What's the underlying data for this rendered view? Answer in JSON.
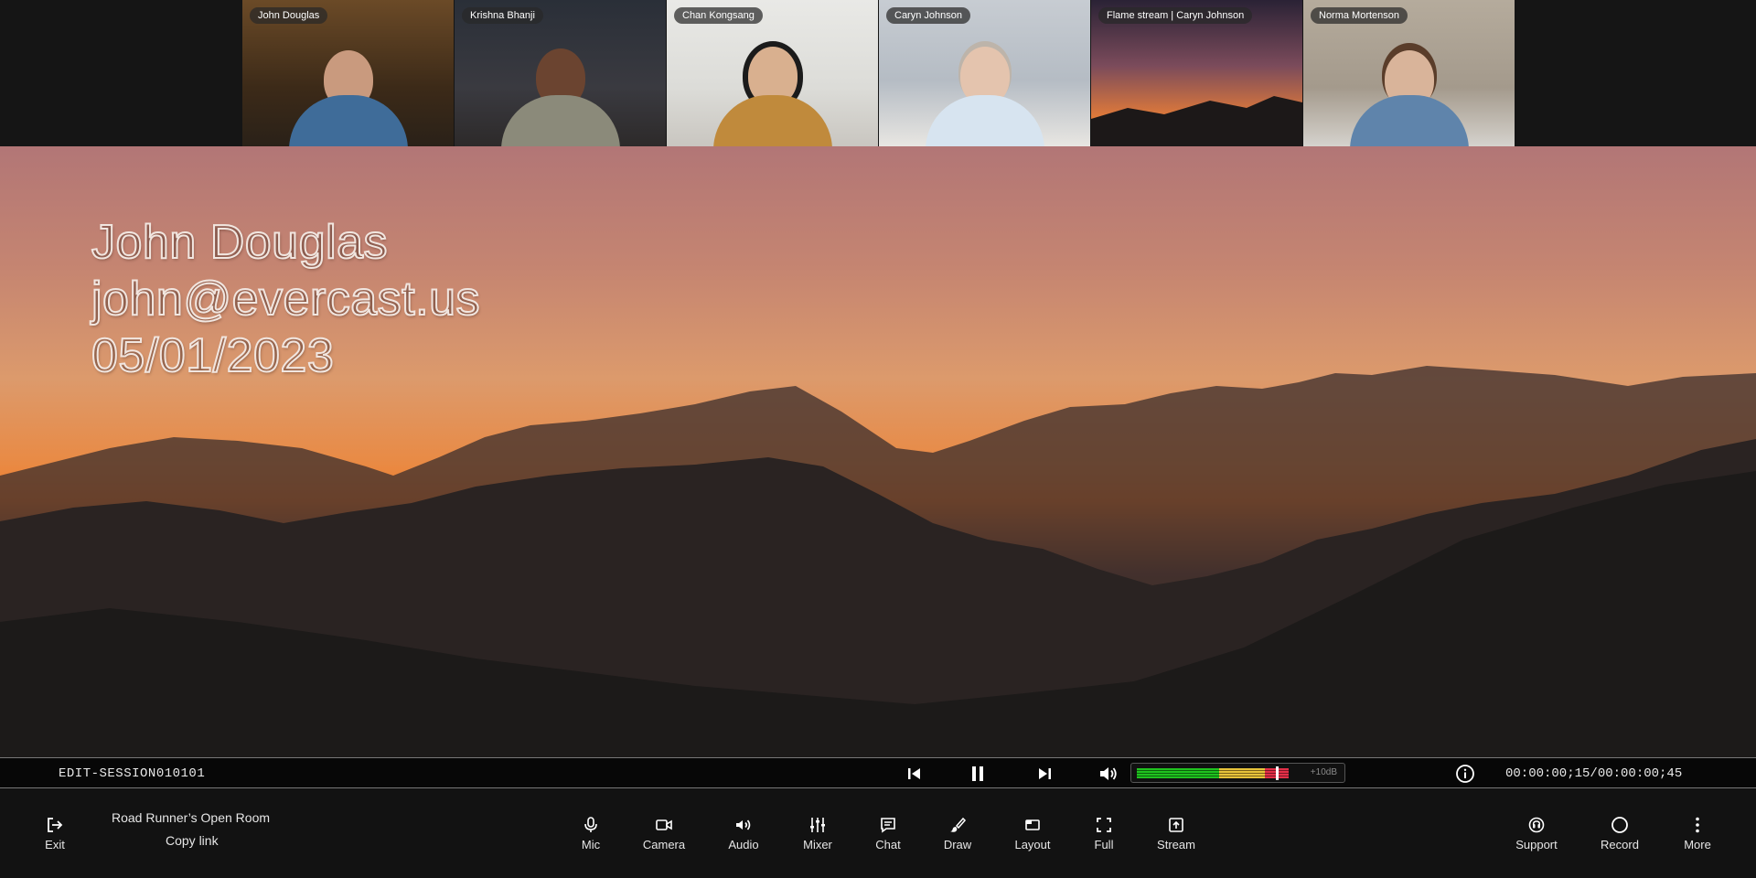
{
  "participants": [
    {
      "name": "John Douglas",
      "skin": "#c99a7e",
      "shirt": "#3f6c99"
    },
    {
      "name": "Krishna Bhanji",
      "skin": "#6b4430",
      "shirt": "#8b8a7a"
    },
    {
      "name": "Chan Kongsang",
      "skin": "#d9b08f",
      "shirt": "#c08a3c"
    },
    {
      "name": "Caryn Johnson",
      "skin": "#e4c4ae",
      "shirt": "#d7e4f0"
    },
    {
      "name": "Flame stream | Caryn Johnson",
      "skin": "",
      "shirt": ""
    },
    {
      "name": "Norma Mortenson",
      "skin": "#d9b49a",
      "shirt": "#5f84ab"
    }
  ],
  "stage": {
    "lines": [
      "John Douglas",
      "john@evercast.us",
      "05/01/2023"
    ]
  },
  "transport": {
    "session_name": "EDIT-SESSION010101",
    "meter_label": "+10dB",
    "meter_level": 0.72,
    "timecode": "00:00:00;15/00:00:00;45"
  },
  "room": {
    "name": "Road Runner’s Open Room",
    "copy_link": "Copy link"
  },
  "toolbar": {
    "exit": "Exit",
    "mic": "Mic",
    "camera": "Camera",
    "audio": "Audio",
    "mixer": "Mixer",
    "chat": "Chat",
    "draw": "Draw",
    "layout": "Layout",
    "full": "Full",
    "stream": "Stream",
    "support": "Support",
    "record": "Record",
    "more": "More"
  },
  "colors": {
    "toolbar_bg": "#121212",
    "transport_bg": "#070707",
    "meter_green": "#1fc21f",
    "meter_yellow": "#e6c33a",
    "meter_red": "#e33048"
  }
}
